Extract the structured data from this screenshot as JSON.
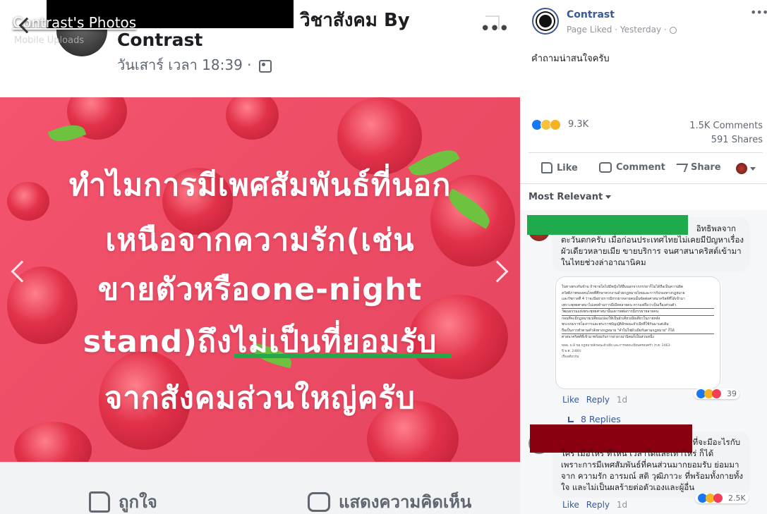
{
  "album_title": "Contrast's Photos",
  "album_sub": "Mobile Uploads",
  "post": {
    "page_name_top": "วิชาสังคม By",
    "page_name": "Contrast",
    "timestamp": "วันเสาร์ เวลา 18:39 ·",
    "image_lines": [
      "ทำไมการมีเพศสัมพันธ์ที่นอก",
      "เหนือจากความรัก(เช่น",
      "ขายตัวหรือone-night",
      "stand)ถึงไม่เป็นที่ยอมรับ",
      "จากสังคมส่วนใหญ่ครับ"
    ],
    "like_label": "ถูกใจ",
    "comment_label": "แสดงความคิดเห็น"
  },
  "sidebar": {
    "page_name": "Contrast",
    "status": "Page Liked · Yesterday ·",
    "caption": "คำถามน่าสนใจครับ",
    "reactions_count": "9.3K",
    "comments_count": "1.5K Comments",
    "shares_count": "591 Shares",
    "like": "Like",
    "comment": "Comment",
    "share": "Share",
    "sort": "Most Relevant",
    "comments": [
      {
        "text_lines": [
          "อิทธิพลจาก",
          "ตะวันตกครับ เมื่อก่อนประเทศไทยไม่เคยมีปัญหาเรื่อง",
          "ผัวเดียวหลายเมีย ขายบริการ จนศาสนาคริสต์เข้ามา",
          "ในไทยช่วงล่าอาณานิคม"
        ],
        "like": "Like",
        "reply": "Reply",
        "time": "1d",
        "reactions": "39",
        "replies": "8 Replies",
        "doc_lines": [
          "ในทางตรงกันข้าม ถ้าชายใดไปมีหญิงให้อื่นนอกจากภรรยาก็ไม่ได้ถือเป็นความผิด",
          "สวัสดิภาพของคนไทยที่ศึกษาพวกงานด้วยกฎหมายไทยและการรับรองทางกฎหมาย",
          "และรัชกาลที่ 4 ว่าจะมีอย่างการมีภรรยาหลายคนนั้นขัดต่อศาสนาคริสต์ที่ได้เข้ามา",
          "เพราะพุทธศาสนาไม่เคยห้ามการมีเมียหลายคน หากแต่ถือว่าเป็นเรื่องส่วนตัว",
          "วัฒนธรรมแห่งพระพุทธศาสนานั้นเคารพต่อการมีภรรยาหลายคน",
          "ก่อนที่จะมีกฎหมายเปลี่ยนแปลงให้เป็นผัวเดียวเมียเดียวในภายหลัง",
          "พระบรมราชโองการและพระราชบัญญัติลักษณะผัวเมียที่ใช้กันมาแต่เดิม",
          "ถือเป็นการทำตามคำสั่งทางกฎหมาย \"คำไม่ใช่ผัวเมียกันตามกฎหมาย\" ก็ได้",
          "ศาสนาคริสต์ที่เข้ามาพร้อมกับการล่าอาณานิคมก็เป็นส่วนหนึ่ง",
          "พพพ. ม.8 ขอ กฎหมายลักษณะผัวเมีย และการจดทะเบียนครอบครัว (ร.ศ. 2463-",
          "ปี พ.ศ. 2480)",
          "เรื่องเดียวกัน"
        ]
      },
      {
        "text_lines": [
          "ที่จะมีอะไรกับ",
          "ใคร เมื่อไหร่ ที่ไหน เวลาใดและเท่าไหร่ ก็ได้",
          "เพราะการมีเพศสัมพันธ์ที่คนส่วนมากยอมรับ ย่อมมา",
          "จาก ความรัก อารมณ์ สติ วุฒิภาวะ ที่พร้อมทั้งกายทั้ง",
          "ใจ และไม่เป็นผลร้ายต่อตัวเองและผู้อื่น"
        ],
        "like": "Like",
        "reply": "Reply",
        "time": "1d",
        "reactions": "2.5K"
      }
    ]
  },
  "colors": {
    "accent": "#385898",
    "redaction_green": "#1faa4b",
    "redaction_red": "#8b0011",
    "underline": "#23a84a"
  }
}
